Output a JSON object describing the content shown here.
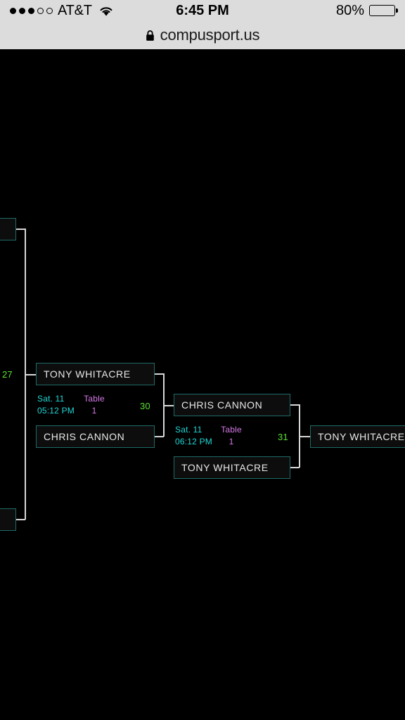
{
  "status_bar": {
    "signal_dots_filled": 3,
    "signal_dots_empty": 2,
    "carrier": "AT&T",
    "wifi_icon": "wifi-icon",
    "time": "6:45 PM",
    "battery_percent": "80%",
    "battery_level": 80
  },
  "browser": {
    "lock_icon": "lock-icon",
    "url": "compusport.us"
  },
  "bracket": {
    "colors": {
      "box_border": "#1e6b66",
      "box_fill": "#0d0d0d",
      "name_text": "#e8e8e8",
      "date_text": "#20d6d6",
      "table_text": "#d87ae8",
      "match_number": "#5ce032",
      "connector": "#d8d8d8",
      "background": "#000000"
    },
    "offscreen_left": {
      "match_number": "27",
      "upper_box_label": "",
      "lower_box_label": ""
    },
    "matches": [
      {
        "id": "match-30",
        "match_number": "30",
        "top_seed": "TONY WHITACRE",
        "bottom_seed": "CHRIS CANNON",
        "date": "Sat. 11",
        "time": "05:12 PM",
        "table_label": "Table",
        "table_number": "1"
      },
      {
        "id": "match-31",
        "match_number": "31",
        "top_seed": "CHRIS CANNON",
        "bottom_seed": "TONY WHITACRE",
        "date": "Sat. 11",
        "time": "06:12 PM",
        "table_label": "Table",
        "table_number": "1"
      }
    ],
    "final": {
      "id": "final-winner",
      "winner": "TONY WHITACRE"
    }
  }
}
